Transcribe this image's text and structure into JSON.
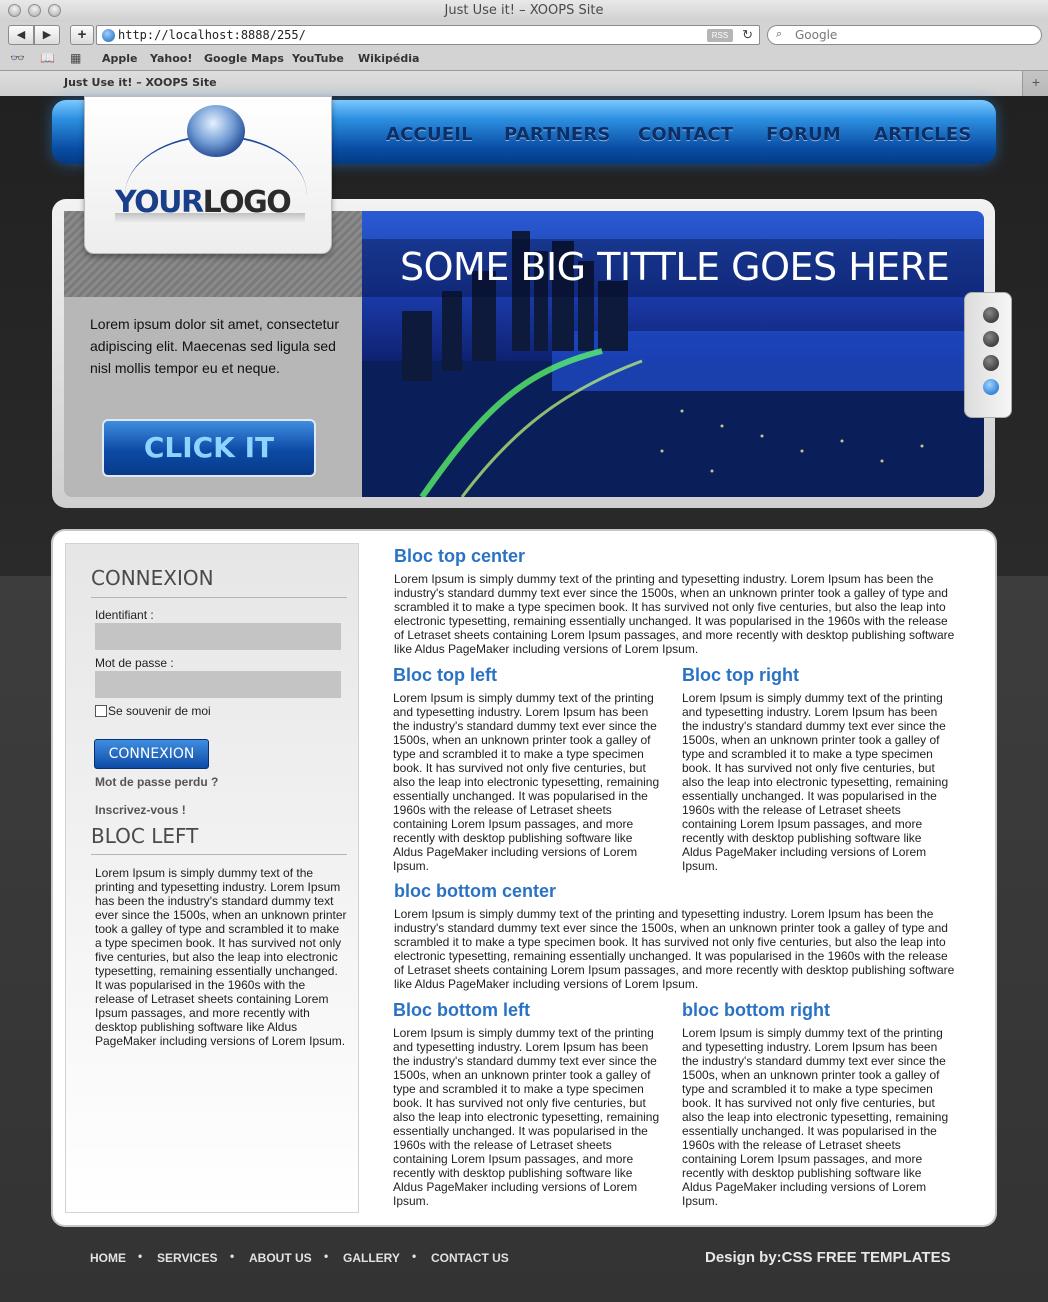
{
  "browser": {
    "window_title": "Just Use it! – XOOPS Site",
    "url": "http://localhost:8888/255/",
    "rss_label": "RSS",
    "search_placeholder": "Google",
    "bookmarks": [
      "Apple",
      "Yahoo!",
      "Google Maps",
      "YouTube",
      "Wikipédia"
    ],
    "tab_title": "Just Use it! – XOOPS Site"
  },
  "site": {
    "logo_your": "YOUR",
    "logo_logo": "LOGO",
    "nav": [
      "ACCUEIL",
      "PARTNERS",
      "CONTACT",
      "FORUM",
      "ARTICLES"
    ],
    "hero": {
      "title": "SOME BIG TITTLE GOES HERE",
      "text": "Lorem ipsum dolor sit amet, consectetur adipiscing elit. Maecenas sed ligula sed nisl mollis tempor eu et neque.",
      "button": "CLICK IT",
      "active_slide": 4,
      "slide_count": 4
    },
    "sidebar": {
      "login_heading": "CONNEXION",
      "id_label": "Identifiant :",
      "id_value": "",
      "pw_label": "Mot de passe :",
      "pw_value": "",
      "remember": "Se souvenir de moi",
      "login_button": "CONNEXION",
      "lost_pw": "Mot de passe perdu ?",
      "register": "Inscrivez-vous !",
      "bloc_left_heading": "BLOC LEFT",
      "bloc_left_text": "Lorem Ipsum is simply dummy text of the printing and typesetting industry. Lorem Ipsum has been the industry's standard dummy text ever since the 1500s, when an unknown printer took a galley of type and scrambled it to make a type specimen book. It has survived not only five centuries, but also the leap into electronic typesetting, remaining essentially unchanged. It was popularised in the 1960s with the release of Letraset sheets containing Lorem Ipsum passages, and more recently with desktop publishing software like Aldus PageMaker including versions of Lorem Ipsum."
    },
    "blocs": {
      "top_center": {
        "title": "Bloc top center",
        "text": "Lorem Ipsum is simply dummy text of the printing and typesetting industry. Lorem Ipsum has been the industry's standard dummy text ever since the 1500s, when an unknown printer took a galley of type and scrambled it to make a type specimen book. It has survived not only five centuries, but also the leap into electronic typesetting, remaining essentially unchanged. It was popularised in the 1960s with the release of Letraset sheets containing Lorem Ipsum passages, and more recently with desktop publishing software like Aldus PageMaker including versions of Lorem Ipsum."
      },
      "top_left": {
        "title": "Bloc top left",
        "text": "Lorem Ipsum is simply dummy text of the printing and typesetting industry. Lorem Ipsum has been the industry's standard dummy text ever since the 1500s, when an unknown printer took a galley of type and scrambled it to make a type specimen book. It has survived not only five centuries, but also the leap into electronic typesetting, remaining essentially unchanged. It was popularised in the 1960s with the release of Letraset sheets containing Lorem Ipsum passages, and more recently with desktop publishing software like Aldus PageMaker including versions of Lorem Ipsum."
      },
      "top_right": {
        "title": "Bloc top right",
        "text": "Lorem Ipsum is simply dummy text of the printing and typesetting industry. Lorem Ipsum has been the industry's standard dummy text ever since the 1500s, when an unknown printer took a galley of type and scrambled it to make a type specimen book. It has survived not only five centuries, but also the leap into electronic typesetting, remaining essentially unchanged. It was popularised in the 1960s with the release of Letraset sheets containing Lorem Ipsum passages, and more recently with desktop publishing software like Aldus PageMaker including versions of Lorem Ipsum."
      },
      "bottom_center": {
        "title": "bloc bottom center",
        "text": "Lorem Ipsum is simply dummy text of the printing and typesetting industry. Lorem Ipsum has been the industry's standard dummy text ever since the 1500s, when an unknown printer took a galley of type and scrambled it to make a type specimen book. It has survived not only five centuries, but also the leap into electronic typesetting, remaining essentially unchanged. It was popularised in the 1960s with the release of Letraset sheets containing Lorem Ipsum passages, and more recently with desktop publishing software like Aldus PageMaker including versions of Lorem Ipsum."
      },
      "bottom_left": {
        "title": "Bloc bottom left",
        "text": "Lorem Ipsum is simply dummy text of the printing and typesetting industry. Lorem Ipsum has been the industry's standard dummy text ever since the 1500s, when an unknown printer took a galley of type and scrambled it to make a type specimen book. It has survived not only five centuries, but also the leap into electronic typesetting, remaining essentially unchanged. It was popularised in the 1960s with the release of Letraset sheets containing Lorem Ipsum passages, and more recently with desktop publishing software like Aldus PageMaker including versions of Lorem Ipsum."
      },
      "bottom_right": {
        "title": "bloc bottom right",
        "text": "Lorem Ipsum is simply dummy text of the printing and typesetting industry. Lorem Ipsum has been the industry's standard dummy text ever since the 1500s, when an unknown printer took a galley of type and scrambled it to make a type specimen book. It has survived not only five centuries, but also the leap into electronic typesetting, remaining essentially unchanged. It was popularised in the 1960s with the release of Letraset sheets containing Lorem Ipsum passages, and more recently with desktop publishing software like Aldus PageMaker including versions of Lorem Ipsum."
      }
    },
    "footer": {
      "links": [
        "HOME",
        "SERVICES",
        "ABOUT US",
        "GALLERY",
        "CONTACT US"
      ],
      "separator": "•",
      "credit": "Design by:CSS FREE TEMPLATES"
    }
  },
  "colors": {
    "accent_blue": "#2a73c4",
    "nav_blue": "#0a4ea6",
    "page_dark": "#1d1d1d"
  }
}
